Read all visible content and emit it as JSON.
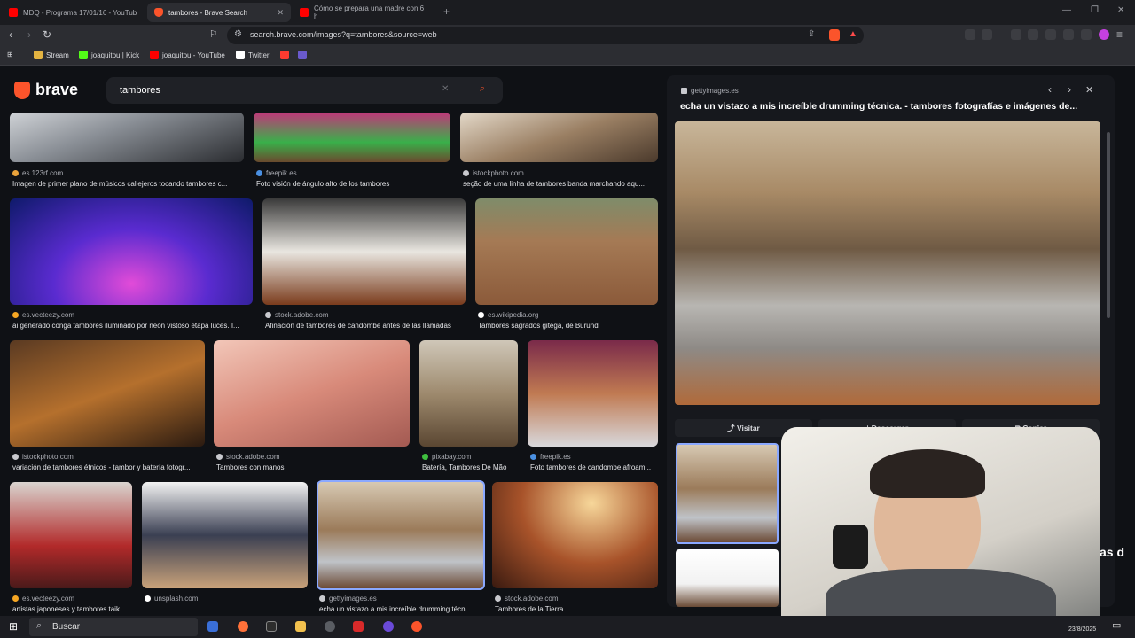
{
  "tabs": [
    {
      "title": "MDQ - Programa 17/01/16 - YouTub",
      "fav_color": "#ff0000"
    },
    {
      "title": "tambores - Brave Search",
      "fav_color": "#fb542b"
    },
    {
      "title": "Cómo se prepara una madre con 6 h",
      "fav_color": "#ff0000"
    }
  ],
  "new_tab": "+",
  "address": {
    "url": "search.brave.com/images?q=tambores&source=web"
  },
  "bookmarks": [
    {
      "label": "Stream",
      "color": "#e3b341"
    },
    {
      "label": "joaquitou | Kick",
      "color": "#53fc18"
    },
    {
      "label": "joaquitou - YouTube",
      "color": "#ff0000"
    },
    {
      "label": "Twitter",
      "color": "#ffffff"
    },
    {
      "label": "",
      "color": "#ff3b30"
    },
    {
      "label": "",
      "color": "#6a5acd"
    }
  ],
  "brand": "brave",
  "search": {
    "query": "tambores"
  },
  "results": [
    {
      "source": "es.123rf.com",
      "caption": "Imagen de primer plano de músicos callejeros tocando tambores c...",
      "dot": "#e9a23b"
    },
    {
      "source": "freepik.es",
      "caption": "Foto visión de ángulo alto de los tambores",
      "dot": "#4a90e2"
    },
    {
      "source": "istockphoto.com",
      "caption": "seção de uma linha de tambores banda marchando aqu...",
      "dot": "#c8c9ce"
    },
    {
      "source": "es.vecteezy.com",
      "caption": "ai generado conga tambores iluminado por neón vistoso etapa luces. I...",
      "dot": "#f5a623"
    },
    {
      "source": "stock.adobe.com",
      "caption": "Afinación de tambores de candombe antes de las llamadas",
      "dot": "#c8c9ce"
    },
    {
      "source": "es.wikipedia.org",
      "caption": "Tambores sagrados gitega, de Burundi",
      "dot": "#ffffff"
    },
    {
      "source": "istockphoto.com",
      "caption": "variación de tambores étnicos - tambor y batería fotogr...",
      "dot": "#c8c9ce"
    },
    {
      "source": "stock.adobe.com",
      "caption": "Tambores con manos",
      "dot": "#c8c9ce"
    },
    {
      "source": "pixabay.com",
      "caption": "Batería, Tambores De Mão",
      "dot": "#3fbf3f"
    },
    {
      "source": "freepik.es",
      "caption": "Foto tambores de candombe afroam...",
      "dot": "#4a90e2"
    },
    {
      "source": "es.vecteezy.com",
      "caption": "artistas japoneses y tambores taik...",
      "dot": "#f5a623"
    },
    {
      "source": "unsplash.com",
      "caption": "",
      "dot": "#ffffff"
    },
    {
      "source": "gettyimages.es",
      "caption": "echa un vistazo a mis increíble drumming técn...",
      "dot": "#c8c9ce"
    },
    {
      "source": "stock.adobe.com",
      "caption": "Tambores de la Tierra",
      "dot": "#c8c9ce"
    }
  ],
  "panel": {
    "source": "gettyimages.es",
    "title": "echa un vistazo a mis increíble drumming técnica. - tambores fotografías e imágenes de...",
    "visit": "Visitar",
    "download": "Descargar",
    "copy": "Copiar"
  },
  "overlay_text": "as d",
  "taskbar": {
    "search": "Buscar",
    "date": "23/8/2025"
  }
}
